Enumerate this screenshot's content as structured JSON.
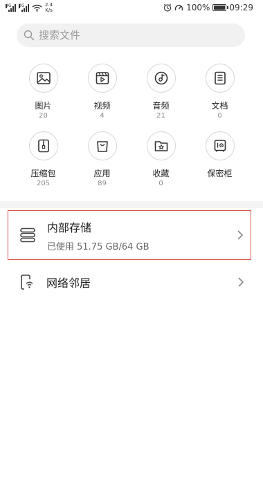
{
  "status_bar": {
    "signal1_tag": "4G",
    "signal2_tag": "2G",
    "net_speed_value": "2.4",
    "net_speed_unit": "K/s",
    "battery": "100%",
    "time": "09:29"
  },
  "search": {
    "placeholder": "搜索文件"
  },
  "categories": [
    {
      "label": "图片",
      "count": "20",
      "icon": "image-icon"
    },
    {
      "label": "视频",
      "count": "4",
      "icon": "video-icon"
    },
    {
      "label": "音频",
      "count": "21",
      "icon": "music-disc-icon"
    },
    {
      "label": "文档",
      "count": "0",
      "icon": "document-icon"
    },
    {
      "label": "压缩包",
      "count": "205",
      "icon": "archive-icon"
    },
    {
      "label": "应用",
      "count": "89",
      "icon": "shopping-bag-icon"
    },
    {
      "label": "收藏",
      "count": "0",
      "icon": "star-folder-icon"
    },
    {
      "label": "保密柜",
      "count": "",
      "icon": "safe-icon"
    }
  ],
  "storage": {
    "title": "内部存储",
    "usage": "已使用 51.75 GB/64 GB",
    "icon": "storage-icon"
  },
  "network": {
    "title": "网络邻居",
    "icon": "network-phone-icon"
  }
}
